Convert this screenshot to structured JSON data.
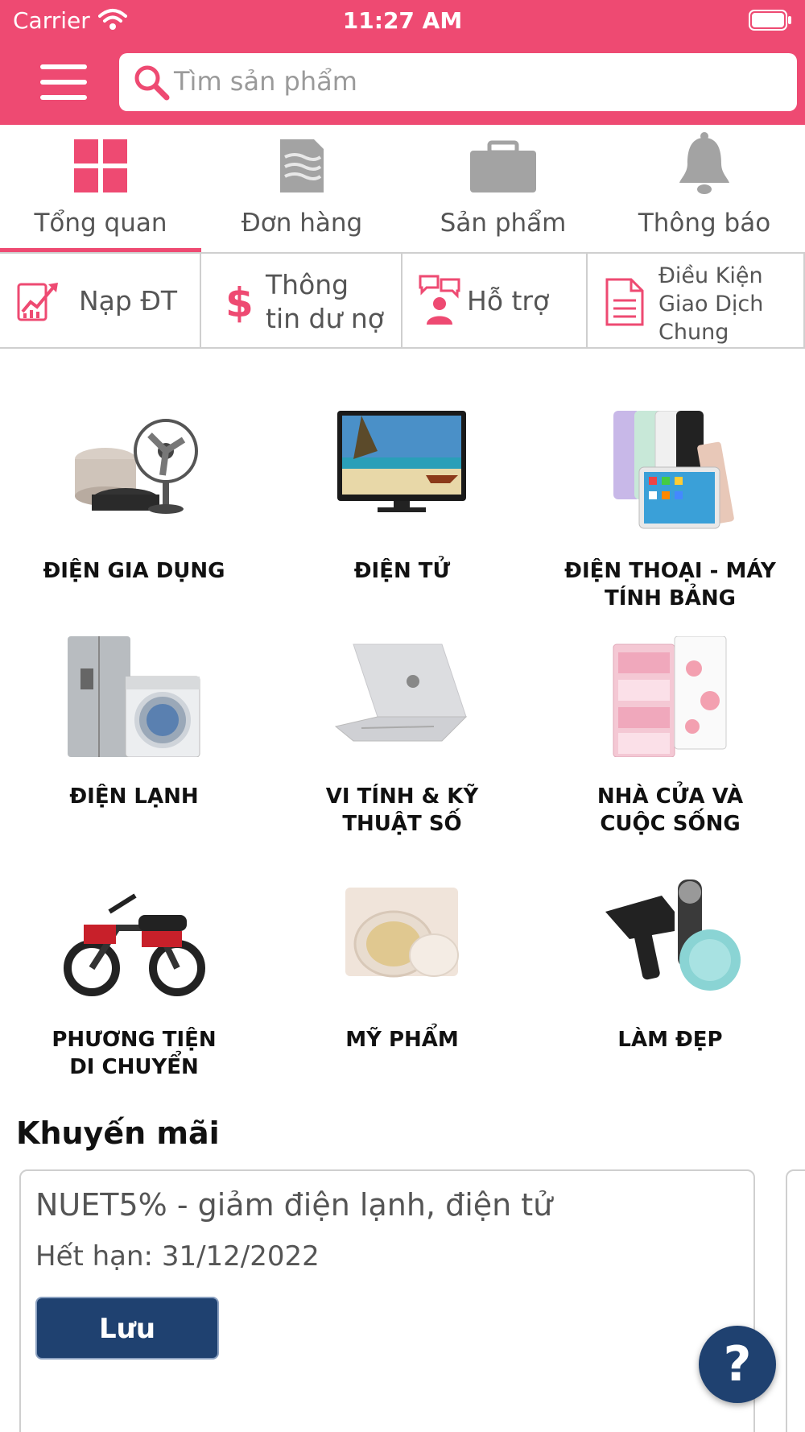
{
  "status_bar": {
    "carrier": "Carrier",
    "time": "11:27 AM"
  },
  "search": {
    "placeholder": "Tìm sản phẩm"
  },
  "tabs": [
    {
      "label": "Tổng quan",
      "icon": "grid-icon",
      "active": true
    },
    {
      "label": "Đơn hàng",
      "icon": "document-icon",
      "active": false
    },
    {
      "label": "Sản phẩm",
      "icon": "briefcase-icon",
      "active": false
    },
    {
      "label": "Thông báo",
      "icon": "bell-icon",
      "active": false
    }
  ],
  "quick_actions": [
    {
      "label": "Nạp ĐT",
      "icon": "chart-up-icon"
    },
    {
      "label_line1": "Thông",
      "label_line2": "tin dư nợ",
      "icon": "dollar-icon"
    },
    {
      "label": "Hỗ trợ",
      "icon": "support-person-icon"
    },
    {
      "label_line1": "Điều Kiện",
      "label_line2": "Giao Dịch",
      "label_line3": "Chung",
      "icon": "paper-icon"
    }
  ],
  "categories": [
    {
      "label": "ĐIỆN GIA DỤNG"
    },
    {
      "label": "ĐIỆN TỬ"
    },
    {
      "label_line1": "ĐIỆN THOẠI - MÁY",
      "label_line2": "TÍNH BẢNG"
    },
    {
      "label": "ĐIỆN LẠNH"
    },
    {
      "label_line1": "VI TÍNH & KỸ",
      "label_line2": "THUẬT SỐ"
    },
    {
      "label_line1": "NHÀ CỬA VÀ",
      "label_line2": "CUỘC SỐNG"
    },
    {
      "label_line1": "PHƯƠNG TIỆN",
      "label_line2": "DI CHUYỂN"
    },
    {
      "label": "MỸ PHẨM"
    },
    {
      "label": "LÀM ĐẸP"
    }
  ],
  "promotions": {
    "title": "Khuyến mãi",
    "items": [
      {
        "code": "NUET5% - giảm điện lạnh, điện tử",
        "expiry": "Hết hạn: 31/12/2022",
        "button": "Lưu"
      }
    ]
  },
  "help_button": "?",
  "colors": {
    "brand": "#ee4a72",
    "button": "#1f4170",
    "icon_gray": "#9e9e9e"
  }
}
